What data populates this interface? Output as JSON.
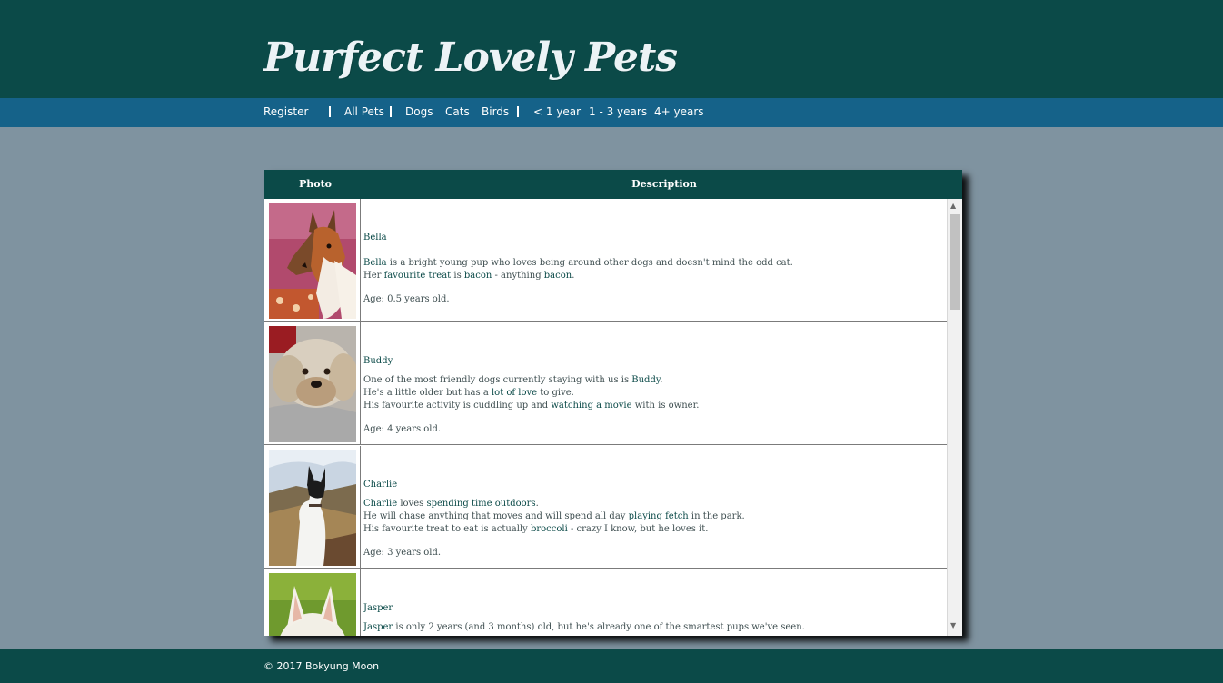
{
  "header": {
    "title": "Purfect Lovely Pets"
  },
  "nav": {
    "register": "Register",
    "all_pets": "All Pets",
    "dogs": "Dogs",
    "cats": "Cats",
    "birds": "Birds",
    "under_1": "< 1 year",
    "one_to_three": "1 - 3 years",
    "four_plus": "4+ years"
  },
  "table": {
    "headers": {
      "photo": "Photo",
      "description": "Description"
    },
    "rows": [
      {
        "name": "Bella",
        "lines": [
          [
            {
              "t": "Bella",
              "h": true
            },
            {
              "t": " is a bright young pup who loves being around other dogs and doesn't mind the odd cat.",
              "h": false
            }
          ],
          [
            {
              "t": "Her ",
              "h": false
            },
            {
              "t": "favourite treat",
              "h": true
            },
            {
              "t": " is ",
              "h": false
            },
            {
              "t": "bacon",
              "h": true
            },
            {
              "t": " - anything ",
              "h": false
            },
            {
              "t": "bacon",
              "h": true
            },
            {
              "t": ".",
              "h": false
            }
          ]
        ],
        "age": "Age: 0.5 years old."
      },
      {
        "name": "Buddy",
        "lines": [
          [
            {
              "t": "One of the most friendly dogs currently staying with us is ",
              "h": false
            },
            {
              "t": "Buddy",
              "h": true
            },
            {
              "t": ".",
              "h": false
            }
          ],
          [
            {
              "t": "He's a little older but has a ",
              "h": false
            },
            {
              "t": "lot of love",
              "h": true
            },
            {
              "t": " to give.",
              "h": false
            }
          ],
          [
            {
              "t": "His favourite activity is cuddling up and ",
              "h": false
            },
            {
              "t": "watching a movie",
              "h": true
            },
            {
              "t": " with is owner.",
              "h": false
            }
          ]
        ],
        "age": "Age: 4 years old."
      },
      {
        "name": "Charlie",
        "lines": [
          [
            {
              "t": "Charlie",
              "h": true
            },
            {
              "t": " loves ",
              "h": false
            },
            {
              "t": "spending time outdoors",
              "h": true
            },
            {
              "t": ".",
              "h": false
            }
          ],
          [
            {
              "t": "He will chase anything that moves and will spend all day ",
              "h": false
            },
            {
              "t": "playing fetch",
              "h": true
            },
            {
              "t": " in the park.",
              "h": false
            }
          ],
          [
            {
              "t": "His favourite treat to eat is actually ",
              "h": false
            },
            {
              "t": "broccoli",
              "h": true
            },
            {
              "t": " - crazy I know, but he loves it.",
              "h": false
            }
          ]
        ],
        "age": "Age: 3 years old."
      },
      {
        "name": "Jasper",
        "lines": [
          [
            {
              "t": "Jasper",
              "h": true
            },
            {
              "t": " is only 2 years (and 3 months) old, but he's already one of the smartest pups we've seen.",
              "h": false
            }
          ]
        ],
        "age": ""
      }
    ]
  },
  "footer": {
    "copyright": "© 2017 Bokyung Moon"
  }
}
